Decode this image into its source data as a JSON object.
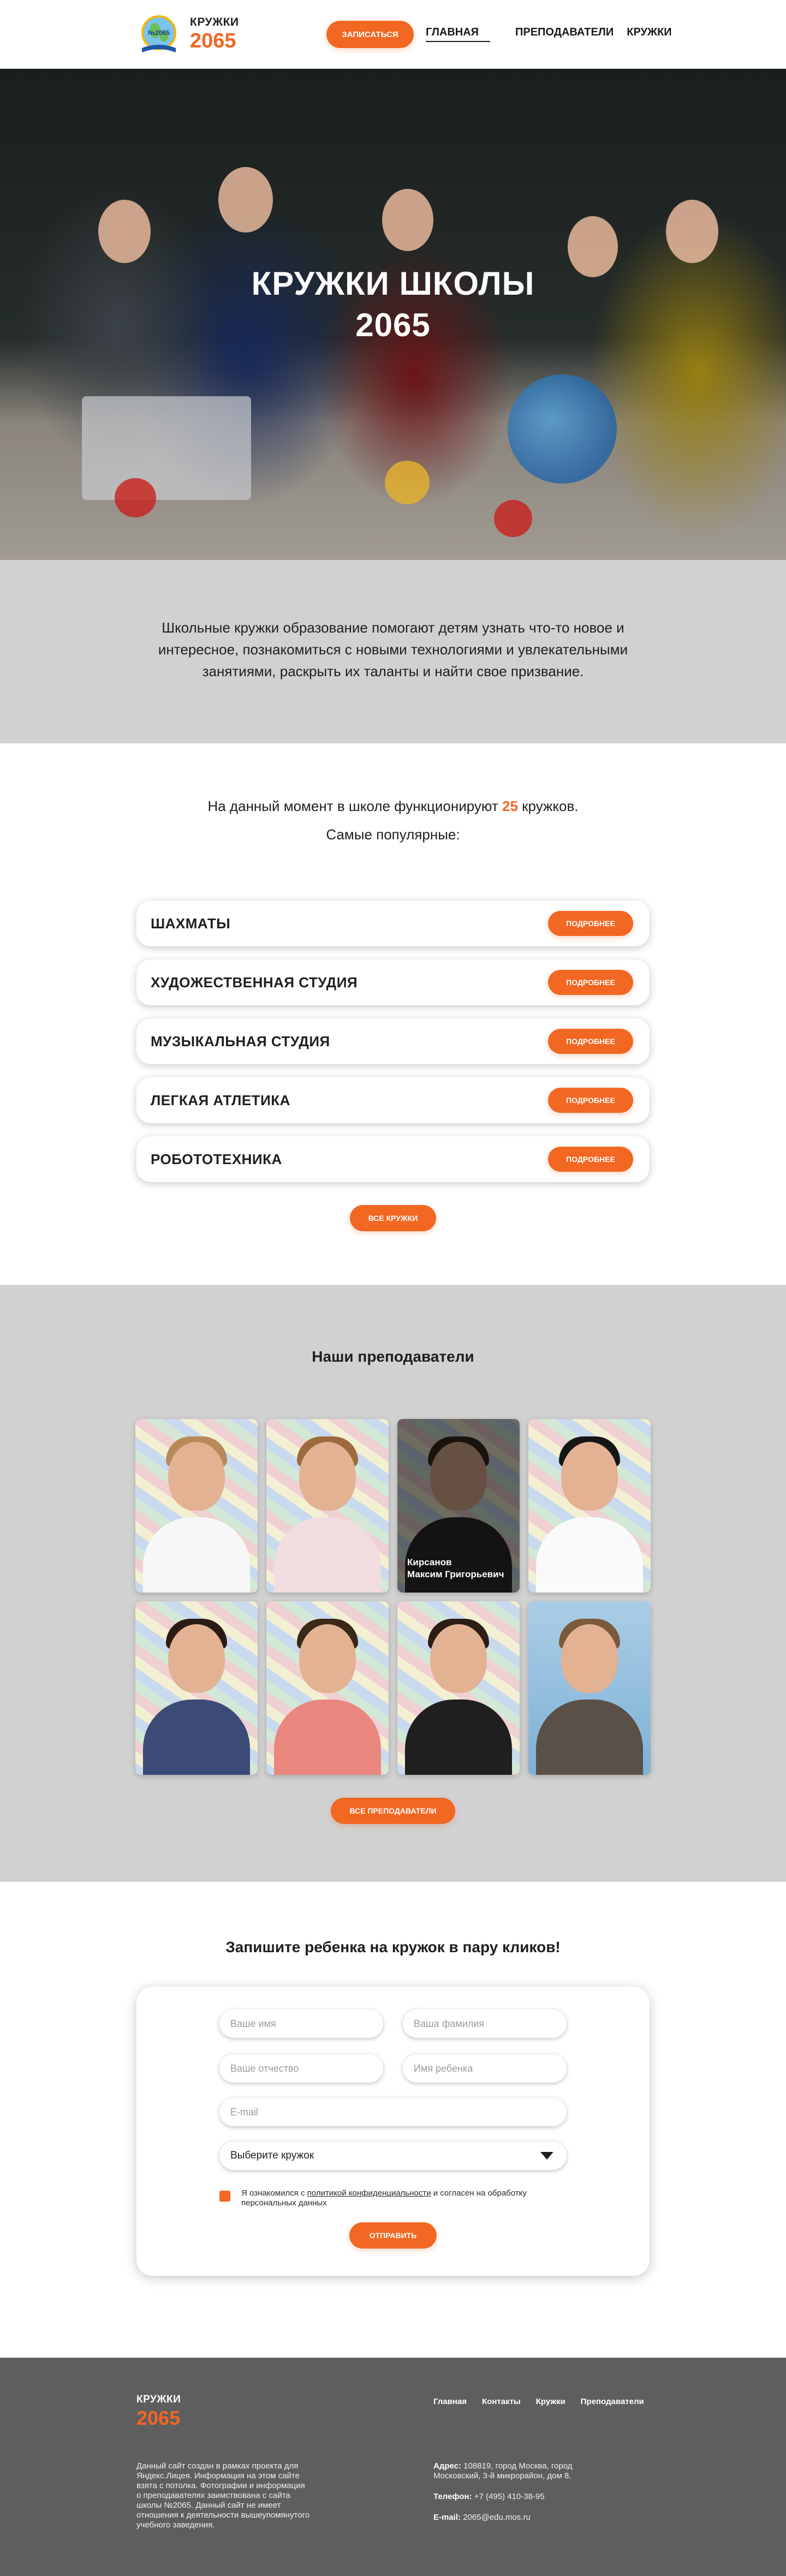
{
  "brand": {
    "line1": "КРУЖКИ",
    "line2": "2065",
    "badge_text": "№2065"
  },
  "header": {
    "enroll_button": "ЗАПИСАТЬСЯ",
    "nav": [
      "ГЛАВНАЯ",
      "ПРЕПОДАВАТЕЛИ",
      "КРУЖКИ"
    ],
    "active_nav": "ГЛАВНАЯ"
  },
  "hero": {
    "title_line1": "КРУЖКИ ШКОЛЫ",
    "title_line2": "2065"
  },
  "intro": {
    "text": "Школьные кружки образование помогают детям узнать что-то новое и интересное, познакомиться с новыми технологиями и увлекательными занятиями, раскрыть их таланты и найти свое призвание."
  },
  "clubs": {
    "count_prefix": "На данный момент в школе функционируют",
    "count_value": "25",
    "count_suffix": "кружков.",
    "popular_label": "Самые популярные:",
    "items": [
      {
        "name": "ШАХМАТЫ",
        "button": "ПОДРОБНЕЕ"
      },
      {
        "name": "ХУДОЖЕСТВЕННАЯ СТУДИЯ",
        "button": "ПОДРОБНЕЕ"
      },
      {
        "name": "МУЗЫКАЛЬНАЯ СТУДИЯ",
        "button": "ПОДРОБНЕЕ"
      },
      {
        "name": "ЛЕГКАЯ АТЛЕТИКА",
        "button": "ПОДРОБНЕЕ"
      },
      {
        "name": "РОБОТОТЕХНИКА",
        "button": "ПОДРОБНЕЕ"
      }
    ],
    "all_button": "ВСЕ КРУЖКИ"
  },
  "teachers": {
    "title": "Наши преподаватели",
    "hovered_name_line1": "Кирсанов",
    "hovered_name_line2": "Максим Григорьевич",
    "all_button": "ВСЕ ПРЕПОДАВАТЕЛИ"
  },
  "form": {
    "title": "Запишите ребенка на кружок в пару кликов!",
    "placeholders": {
      "name": "Ваше имя",
      "surname": "Ваша фамилия",
      "patronymic": "Ваше отчество",
      "child_name": "Имя ребенка",
      "email": "E-mail"
    },
    "select_value": "Выберите кружок",
    "agree_prefix": "Я ознакомился с",
    "agree_link": "политикой конфиденциальности",
    "agree_suffix": "и согласен на обработку персональных данных",
    "submit": "ОТПРАВИТЬ"
  },
  "footer": {
    "logo_line1": "КРУЖКИ",
    "logo_line2": "2065",
    "nav": [
      "Главная",
      "Контакты",
      "Кружки",
      "Преподаватели"
    ],
    "about": "Данный сайт создан в рамках проекта для Яндекс.Лицея. Информация на этом сайте взята с потолка. Фотографии и информация о преподавателях заимствована с сайта школы №2065. Данный сайт не имеет отношения к деятельности вышеупомянутого учебного заведения.",
    "address_label": "Адрес:",
    "address": "108819, город Москва, город Московский, 3-й микрорайон, дом 8.",
    "phone_label": "Телефон:",
    "phone": "+7 (495) 410-38-95",
    "email_label": "E-mail:",
    "email": "2065@edu.mos.ru"
  },
  "colors": {
    "accent": "#f26722",
    "section_gray": "#d1d1d1",
    "footer_bg": "#5e5e5e"
  }
}
